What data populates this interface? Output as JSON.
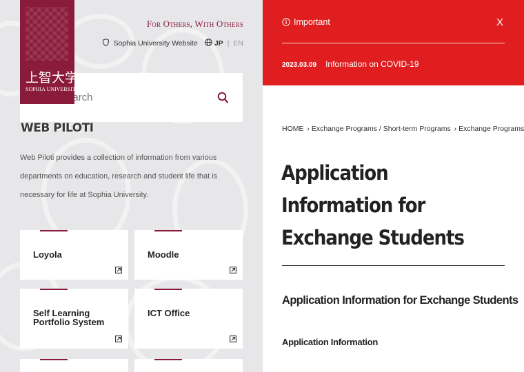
{
  "colors": {
    "brand": "#8a1b3b",
    "alert": "#e01e1f"
  },
  "left": {
    "logo": {
      "kanji": "上智大学",
      "roman": "SOPHIA UNIVERSITY"
    },
    "tagline": "For Others, With Others",
    "site_link": "Sophia University Website",
    "lang_jp": "JP",
    "lang_sep": "|",
    "lang_en": "EN",
    "search": {
      "placeholder": "Search"
    },
    "piloti_label": "WEB PILOTI",
    "description": "Web Piloti provides a collection of information from various departments on education, research and student life that is necessary for life at Sophia University.",
    "cards": [
      {
        "title": "Loyola",
        "icon": "external-link-icon"
      },
      {
        "title": "Moodle",
        "icon": "external-link-icon"
      },
      {
        "title": "Self Learning Portfolio System",
        "icon": "external-link-icon"
      },
      {
        "title": "ICT Office",
        "icon": "external-link-icon"
      }
    ]
  },
  "right": {
    "alert": {
      "title": "Important",
      "close": "X",
      "date": "2023.03.09",
      "text": "Information on COVID-19"
    },
    "breadcrumb": [
      "HOME",
      "Exchange Programs / Short-term Programs",
      "Exchange Programs"
    ],
    "page_title": "Application Information for Exchange Students",
    "section_title": "Application Information for Exchange Students",
    "subsection_title": "Application Information"
  }
}
